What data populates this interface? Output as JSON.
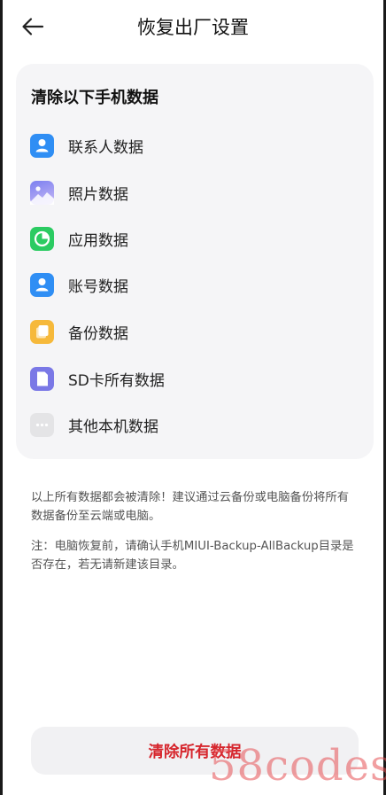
{
  "header": {
    "title": "恢复出厂设置"
  },
  "card": {
    "title": "清除以下手机数据",
    "items": [
      {
        "label": "联系人数据",
        "icon": "contact-icon",
        "color": "#2f8ef4"
      },
      {
        "label": "照片数据",
        "icon": "photo-icon",
        "color": "#8a8ef0"
      },
      {
        "label": "应用数据",
        "icon": "app-icon",
        "color": "#2bcb62"
      },
      {
        "label": "账号数据",
        "icon": "account-icon",
        "color": "#2f8ef4"
      },
      {
        "label": "备份数据",
        "icon": "backup-icon",
        "color": "#f6b93b"
      },
      {
        "label": "SD卡所有数据",
        "icon": "sd-card-icon",
        "color": "#7a78e6"
      },
      {
        "label": "其他本机数据",
        "icon": "more-icon",
        "color": "#e4e4e6"
      }
    ]
  },
  "notes": [
    "以上所有数据都会被清除！建议通过云备份或电脑备份将所有数据备份至云端或电脑。",
    "注：电脑恢复前，请确认手机MIUI-Backup-AllBackup目录是否存在，若无请新建该目录。"
  ],
  "action": {
    "label": "清除所有数据",
    "color": "#d6262d"
  },
  "watermark": "58codes"
}
